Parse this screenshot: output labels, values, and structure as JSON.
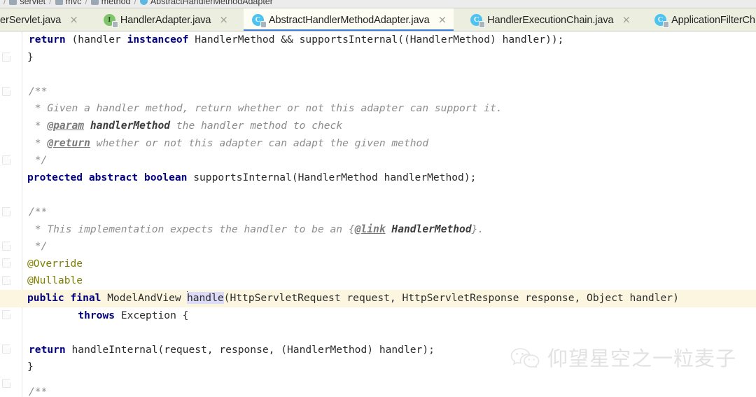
{
  "breadcrumb": {
    "items": [
      {
        "label": "servlet",
        "icon": "folder-icon"
      },
      {
        "label": "mvc",
        "icon": "folder-icon"
      },
      {
        "label": "method",
        "icon": "folder-icon"
      },
      {
        "label": "AbstractHandlerMethodAdapter",
        "icon": "class-icon"
      }
    ],
    "separator": "/"
  },
  "tabs": {
    "close_glyph": "×",
    "items": [
      {
        "label": "erServlet.java",
        "icon": "class-icon",
        "icon_letter": "C",
        "icon_kind": "c",
        "active": false,
        "truncated_left": true
      },
      {
        "label": "HandlerAdapter.java",
        "icon": "interface-icon",
        "icon_letter": "I",
        "icon_kind": "i",
        "active": false
      },
      {
        "label": "AbstractHandlerMethodAdapter.java",
        "icon": "class-icon",
        "icon_letter": "C",
        "icon_kind": "c",
        "active": true
      },
      {
        "label": "HandlerExecutionChain.java",
        "icon": "class-icon",
        "icon_letter": "C",
        "icon_kind": "c",
        "active": false
      },
      {
        "label": "ApplicationFilterCh",
        "icon": "class-icon",
        "icon_letter": "C",
        "icon_kind": "c",
        "active": false,
        "truncated_right": true
      }
    ]
  },
  "editor": {
    "file": "AbstractHandlerMethodAdapter.java",
    "language": "java",
    "current_line_index": 14,
    "selection_text": "handle",
    "colors": {
      "background": "#ffffff",
      "current_line": "#fcf6e0",
      "selection": "#dcdcfa",
      "keyword": "#000080",
      "annotation": "#808000",
      "comment": "#8c8c8c",
      "text": "#2b2b2b",
      "tab_active_underline": "#3b7ddd",
      "tab_bar_background": "#eceee0"
    },
    "lines": [
      {
        "i": 0,
        "text": "    return (handler instanceof HandlerMethod && supportsInternal((HandlerMethod) handler));"
      },
      {
        "i": 1,
        "text": "}"
      },
      {
        "i": 2,
        "text": ""
      },
      {
        "i": 3,
        "text": "/**"
      },
      {
        "i": 4,
        "text": " * Given a handler method, return whether or not this adapter can support it."
      },
      {
        "i": 5,
        "text": " * @param handlerMethod the handler method to check"
      },
      {
        "i": 6,
        "text": " * @return whether or not this adapter can adapt the given method"
      },
      {
        "i": 7,
        "text": " */"
      },
      {
        "i": 8,
        "text": "protected abstract boolean supportsInternal(HandlerMethod handlerMethod);"
      },
      {
        "i": 9,
        "text": ""
      },
      {
        "i": 10,
        "text": "/**"
      },
      {
        "i": 11,
        "text": " * This implementation expects the handler to be an {@link HandlerMethod}."
      },
      {
        "i": 12,
        "text": " */"
      },
      {
        "i": 13,
        "text": "@Override"
      },
      {
        "i": 14,
        "text": "@Nullable"
      },
      {
        "i": 15,
        "text": "public final ModelAndView handle(HttpServletRequest request, HttpServletResponse response, Object handler)"
      },
      {
        "i": 16,
        "text": "        throws Exception {"
      },
      {
        "i": 17,
        "text": ""
      },
      {
        "i": 18,
        "text": "    return handleInternal(request, response, (HandlerMethod) handler);"
      },
      {
        "i": 19,
        "text": "}"
      },
      {
        "i": 20,
        "text": ""
      },
      {
        "i": 21,
        "text": "/**"
      }
    ]
  },
  "watermark": {
    "text": "仰望星空之一粒麦子",
    "icon": "wechat-icon"
  }
}
